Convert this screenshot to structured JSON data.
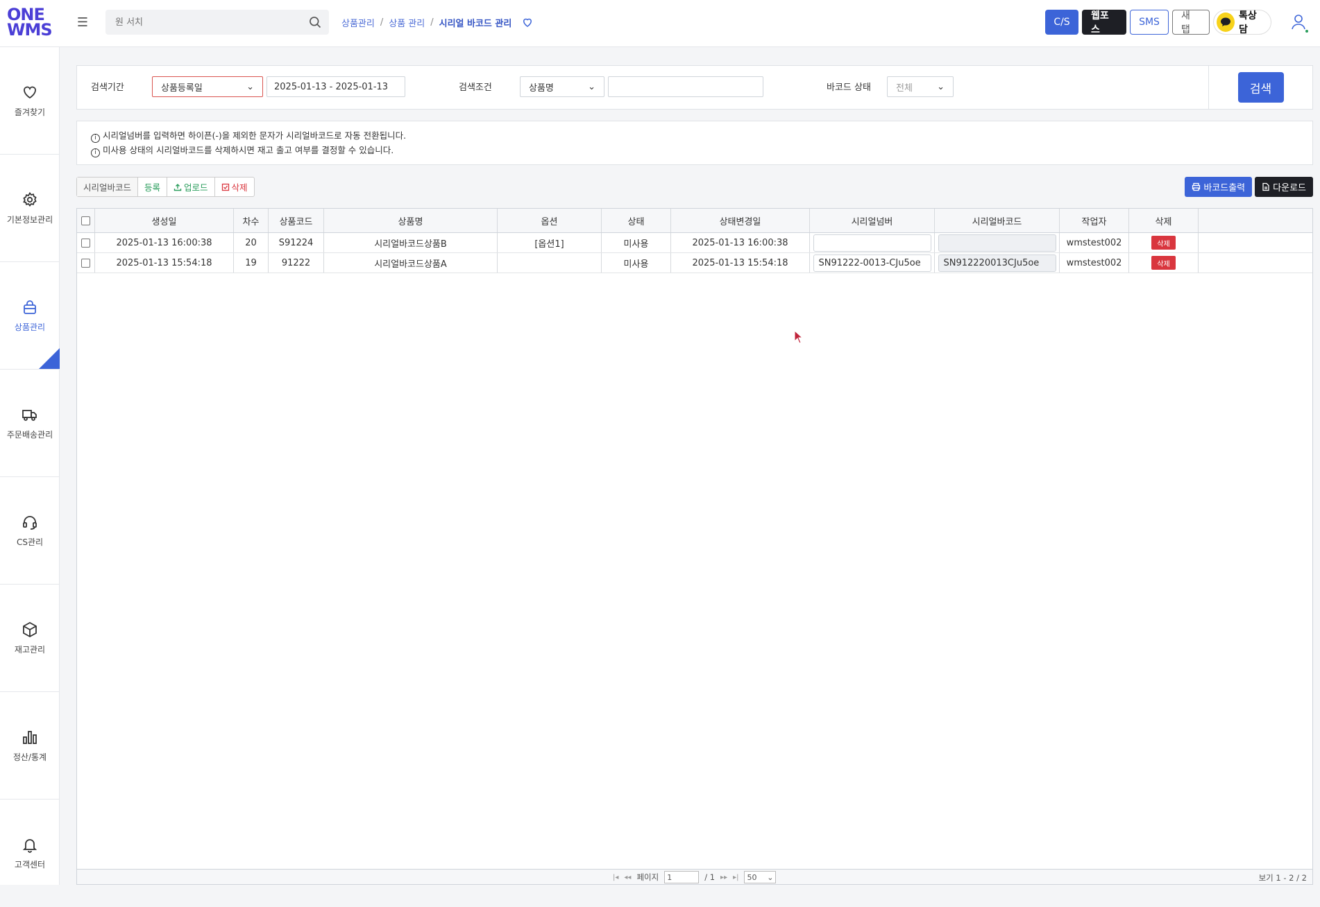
{
  "logo": {
    "line1": "ONE",
    "line2": "WMS"
  },
  "search": {
    "placeholder": "원 서치"
  },
  "breadcrumb": {
    "items": [
      "상품관리",
      "상품 관리"
    ],
    "current": "시리얼 바코드 관리",
    "sep": "/"
  },
  "topbar": {
    "cs": "C/S",
    "webpos": "웹포스",
    "sms": "SMS",
    "newtab": "새 탭",
    "talk": "톡상담"
  },
  "sidebar": {
    "items": [
      {
        "label": "즐겨찾기",
        "icon": "heart-icon"
      },
      {
        "label": "기본정보관리",
        "icon": "gear-icon"
      },
      {
        "label": "상품관리",
        "icon": "bag-icon",
        "active": true
      },
      {
        "label": "주문배송관리",
        "icon": "truck-icon"
      },
      {
        "label": "CS관리",
        "icon": "headset-icon"
      },
      {
        "label": "재고관리",
        "icon": "box-icon"
      },
      {
        "label": "정산/통계",
        "icon": "bar-chart-icon"
      },
      {
        "label": "고객센터",
        "icon": "bell-icon"
      }
    ]
  },
  "filter": {
    "period_label": "검색기간",
    "period_type": "상품등록일",
    "date_range": "2025-01-13 - 2025-01-13",
    "cond_label": "검색조건",
    "cond_type": "상품명",
    "cond_value": "",
    "status_label": "바코드 상태",
    "status_value": "전체",
    "search_btn": "검색"
  },
  "notice": {
    "line1": "시리얼넘버를 입력하면 하이픈(-)을 제외한 문자가 시리얼바코드로 자동 전환됩니다.",
    "line2": "미사용 상태의 시리얼바코드를 삭제하시면 재고 출고 여부를 결정할 수 있습니다."
  },
  "actions": {
    "label": "시리얼바코드",
    "register": "등록",
    "upload": "업로드",
    "delete": "삭제",
    "print": "바코드출력",
    "download": "다운로드"
  },
  "table": {
    "headers": [
      "생성일",
      "차수",
      "상품코드",
      "상품명",
      "옵션",
      "상태",
      "상태변경일",
      "시리얼넘버",
      "시리얼바코드",
      "작업자",
      "삭제"
    ],
    "rows": [
      {
        "created": "2025-01-13 16:00:38",
        "seq": "20",
        "code": "S91224",
        "name": "시리얼바코드상품B",
        "option": "[옵션1]",
        "status": "미사용",
        "changed": "2025-01-13 16:00:38",
        "serial": "",
        "barcode": "",
        "worker": "wmstest002",
        "del": "삭제"
      },
      {
        "created": "2025-01-13 15:54:18",
        "seq": "19",
        "code": "91222",
        "name": "시리얼바코드상품A",
        "option": "",
        "status": "미사용",
        "changed": "2025-01-13 15:54:18",
        "serial": "SN91222-0013-CJu5oe",
        "barcode": "SN912220013CJu5oe",
        "worker": "wmstest002",
        "del": "삭제"
      }
    ]
  },
  "pager": {
    "page_label": "페이지",
    "page": "1",
    "total": "/ 1",
    "size": "50",
    "view": "보기 1 - 2 / 2"
  },
  "colors": {
    "accent": "#3c64d8",
    "danger": "#d9363e",
    "brand": "#4b3fd6"
  }
}
